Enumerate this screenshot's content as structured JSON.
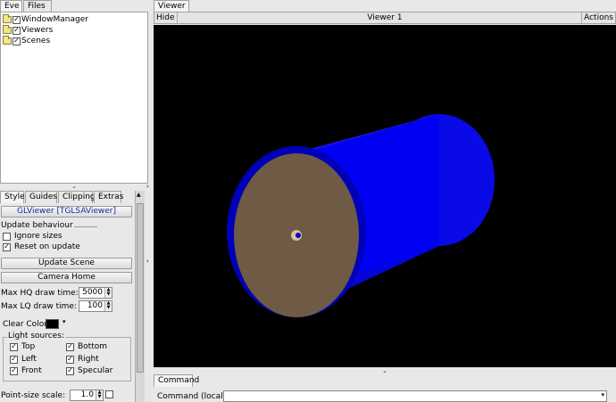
{
  "left_tabs": [
    "Eve",
    "Files"
  ],
  "tree": [
    {
      "label": "WindowManager",
      "checked": true
    },
    {
      "label": "Viewers",
      "checked": true
    },
    {
      "label": "Scenes",
      "checked": true
    }
  ],
  "editor_tabs": [
    "Style",
    "Guides",
    "Clipping",
    "Extras"
  ],
  "viewer_button": "GLViewer [TGLSAViewer]",
  "update_behaviour": "Update behaviour",
  "ignore_sizes": {
    "label": "Ignore sizes",
    "checked": false
  },
  "reset_on_update": {
    "label": "Reset on update",
    "checked": true
  },
  "update_scene_button": "Update Scene",
  "camera_home_button": "Camera Home",
  "max_hq": {
    "label": "Max HQ draw time:",
    "value": "5000"
  },
  "max_lq": {
    "label": "Max LQ draw time:",
    "value": "100"
  },
  "clear_color": {
    "label": "Clear Color",
    "color": "#000000"
  },
  "light_sources": {
    "title": "Light sources:",
    "items": [
      {
        "label": "Top",
        "checked": true
      },
      {
        "label": "Bottom",
        "checked": true
      },
      {
        "label": "Left",
        "checked": true
      },
      {
        "label": "Right",
        "checked": true
      },
      {
        "label": "Front",
        "checked": true
      },
      {
        "label": "Specular",
        "checked": true
      }
    ]
  },
  "point_size": {
    "label": "Point-size scale:",
    "value": "1.0"
  },
  "viewer_tab": "Viewer 1",
  "viewer_header": {
    "hide": "Hide",
    "title": "Viewer 1",
    "actions": "Actions"
  },
  "command_tab": "Command",
  "command_label": "Command (local):",
  "command_value": "",
  "colors": {
    "viewport_bg": "#000000",
    "cylinder_blue": "#1010ee",
    "cap_face": "#6e5a45"
  }
}
